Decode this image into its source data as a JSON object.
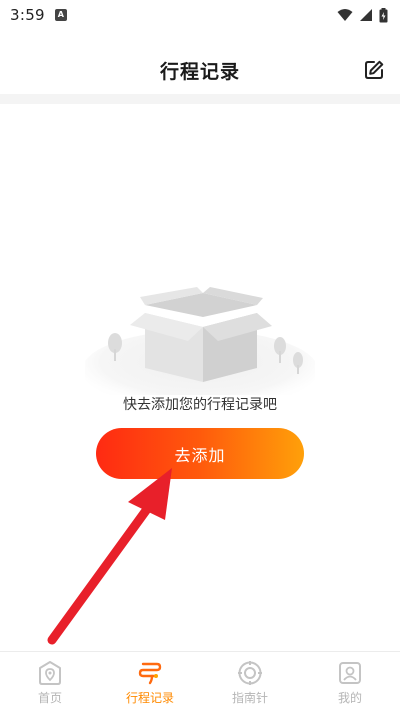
{
  "status_bar": {
    "time": "3:59",
    "notification_icon": "A"
  },
  "header": {
    "title": "行程记录",
    "edit_icon": "edit-icon"
  },
  "empty_state": {
    "illustration": "empty-box-illustration",
    "message": "快去添加您的行程记录吧",
    "add_button_label": "去添加"
  },
  "tabs": [
    {
      "label": "首页",
      "icon": "home-icon",
      "active": false
    },
    {
      "label": "行程记录",
      "icon": "trip-record-icon",
      "active": true
    },
    {
      "label": "指南针",
      "icon": "compass-icon",
      "active": false
    },
    {
      "label": "我的",
      "icon": "profile-icon",
      "active": false
    }
  ],
  "colors": {
    "accent": "#ff8a00",
    "button_gradient_start": "#ff2a12",
    "button_gradient_end": "#ffa00a",
    "arrow": "#e8202a",
    "inactive_tab": "#b5b5b5"
  }
}
